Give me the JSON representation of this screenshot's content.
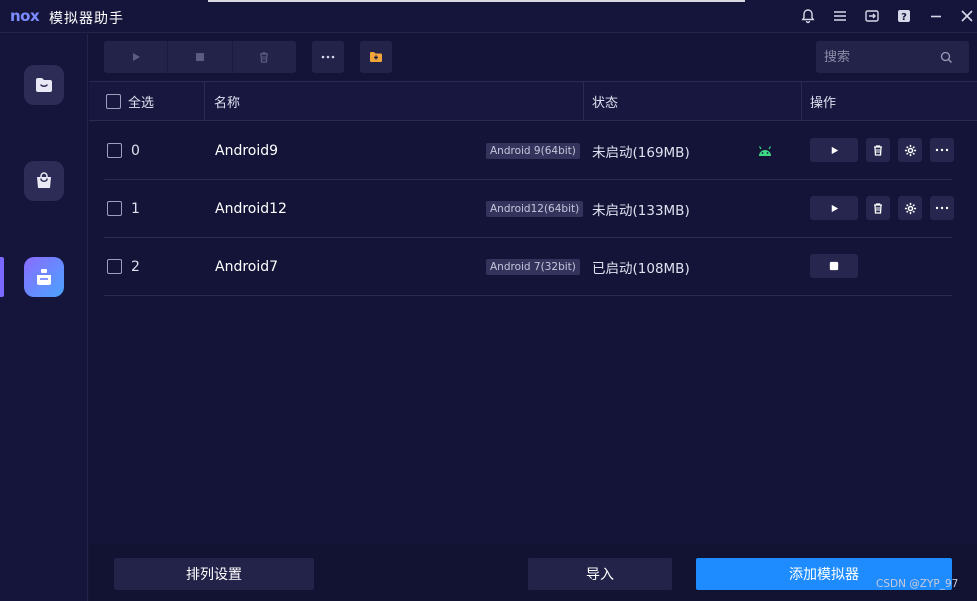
{
  "app": {
    "logo": "nox-logo",
    "title": "模拟器助手"
  },
  "titlebar_icons": [
    "bell-icon",
    "menu-icon",
    "export-icon",
    "help-icon",
    "minimize-icon",
    "close-icon"
  ],
  "sidebar": {
    "items": [
      {
        "icon": "folder-icon",
        "active": false
      },
      {
        "icon": "store-bag-icon",
        "active": false
      },
      {
        "icon": "multi-instance-icon",
        "active": true
      }
    ]
  },
  "toolbar": {
    "icons": [
      "play-icon",
      "stop-icon",
      "delete-icon",
      "more-icon",
      "add-folder-icon"
    ]
  },
  "search": {
    "placeholder": "搜索"
  },
  "table": {
    "headers": {
      "select_all": "全选",
      "name": "名称",
      "status": "状态",
      "actions": "操作"
    },
    "rows": [
      {
        "index": "0",
        "name": "Android9",
        "tag": "Android 9(64bit)",
        "status": "未启动(169MB)",
        "running": false,
        "android_icon": true
      },
      {
        "index": "1",
        "name": "Android12",
        "tag": "Android12(64bit)",
        "status": "未启动(133MB)",
        "running": false,
        "android_icon": false
      },
      {
        "index": "2",
        "name": "Android7",
        "tag": "Android 7(32bit)",
        "status": "已启动(108MB)",
        "running": true,
        "android_icon": false
      }
    ]
  },
  "footer": {
    "sort_label": "排列设置",
    "import_label": "导入",
    "add_label": "添加模拟器"
  },
  "watermark": "CSDN @ZYP_97",
  "colors": {
    "background": "#141438",
    "panel": "#23234a",
    "accent": "#1e8cff",
    "active_gradient_start": "#8a6cff",
    "active_gradient_end": "#4aa3ff",
    "android_green": "#3ddc84"
  }
}
